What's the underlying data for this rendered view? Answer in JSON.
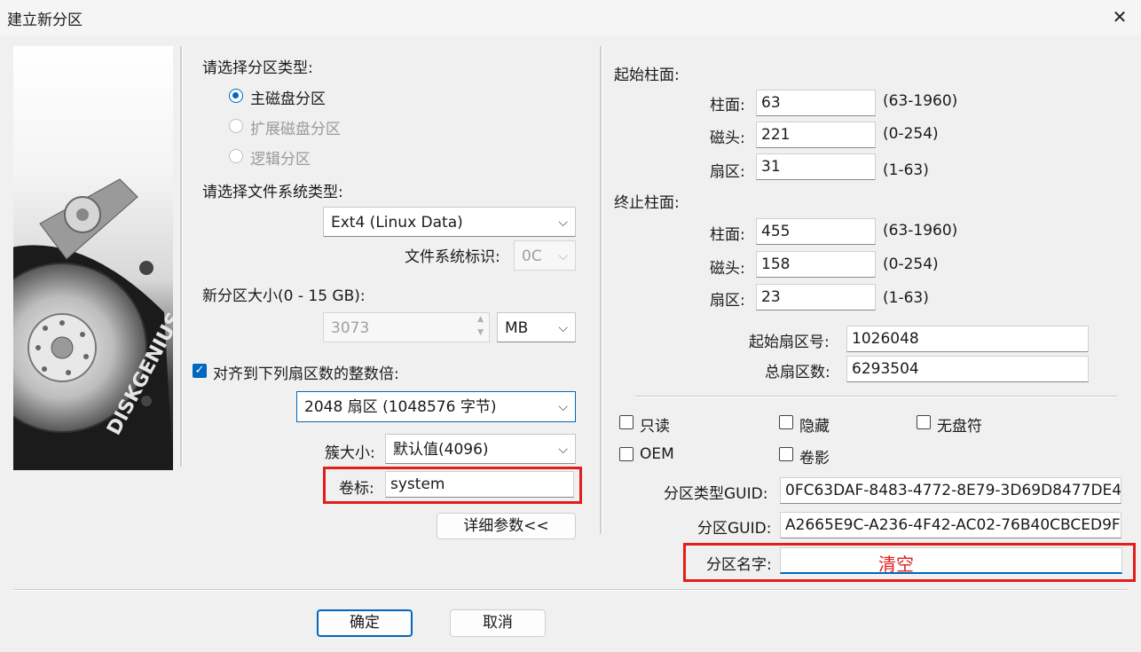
{
  "window": {
    "title": "建立新分区"
  },
  "left": {
    "partition_type_label": "请选择分区类型:",
    "radios": [
      {
        "label": "主磁盘分区",
        "selected": true,
        "enabled": true
      },
      {
        "label": "扩展磁盘分区",
        "selected": false,
        "enabled": false
      },
      {
        "label": "逻辑分区",
        "selected": false,
        "enabled": false
      }
    ],
    "fs_type_label": "请选择文件系统类型:",
    "fs_type_value": "Ext4 (Linux Data)",
    "fs_id_label": "文件系统标识:",
    "fs_id_value": "0C",
    "size_label": "新分区大小(0 - 15 GB):",
    "size_value": "3073",
    "size_unit": "MB",
    "align_label": "对齐到下列扇区数的整数倍:",
    "align_checked": true,
    "align_value": "2048 扇区 (1048576 字节)",
    "cluster_label": "簇大小:",
    "cluster_value": "默认值(4096)",
    "volume_label": "卷标:",
    "volume_value": "system",
    "details_button": "详细参数<<"
  },
  "right": {
    "start_header": "起始柱面:",
    "end_header": "终止柱面:",
    "cyl_label": "柱面:",
    "head_label": "磁头:",
    "sector_label": "扇区:",
    "start": {
      "cyl": "63",
      "cyl_range": "(63-1960)",
      "head": "221",
      "head_range": "(0-254)",
      "sector": "31",
      "sector_range": "(1-63)"
    },
    "end": {
      "cyl": "455",
      "cyl_range": "(63-1960)",
      "head": "158",
      "head_range": "(0-254)",
      "sector": "23",
      "sector_range": "(1-63)"
    },
    "start_sector_label": "起始扇区号:",
    "start_sector_value": "1026048",
    "total_sectors_label": "总扇区数:",
    "total_sectors_value": "6293504",
    "checkboxes": [
      {
        "label": "只读",
        "checked": false
      },
      {
        "label": "隐藏",
        "checked": false
      },
      {
        "label": "无盘符",
        "checked": false
      },
      {
        "label": "OEM",
        "checked": false
      },
      {
        "label": "卷影",
        "checked": false
      }
    ],
    "type_guid_label": "分区类型GUID:",
    "type_guid_value": "0FC63DAF-8483-4772-8E79-3D69D8477DE4",
    "part_guid_label": "分区GUID:",
    "part_guid_value": "A2665E9C-A236-4F42-AC02-76B40CBCED9F",
    "part_name_label": "分区名字:",
    "part_name_annotation": "清空"
  },
  "footer": {
    "ok": "确定",
    "cancel": "取消"
  },
  "image_text": "DISKGENIUS",
  "colors": {
    "accent": "#0067c0",
    "highlight_red": "#e31c1c"
  }
}
